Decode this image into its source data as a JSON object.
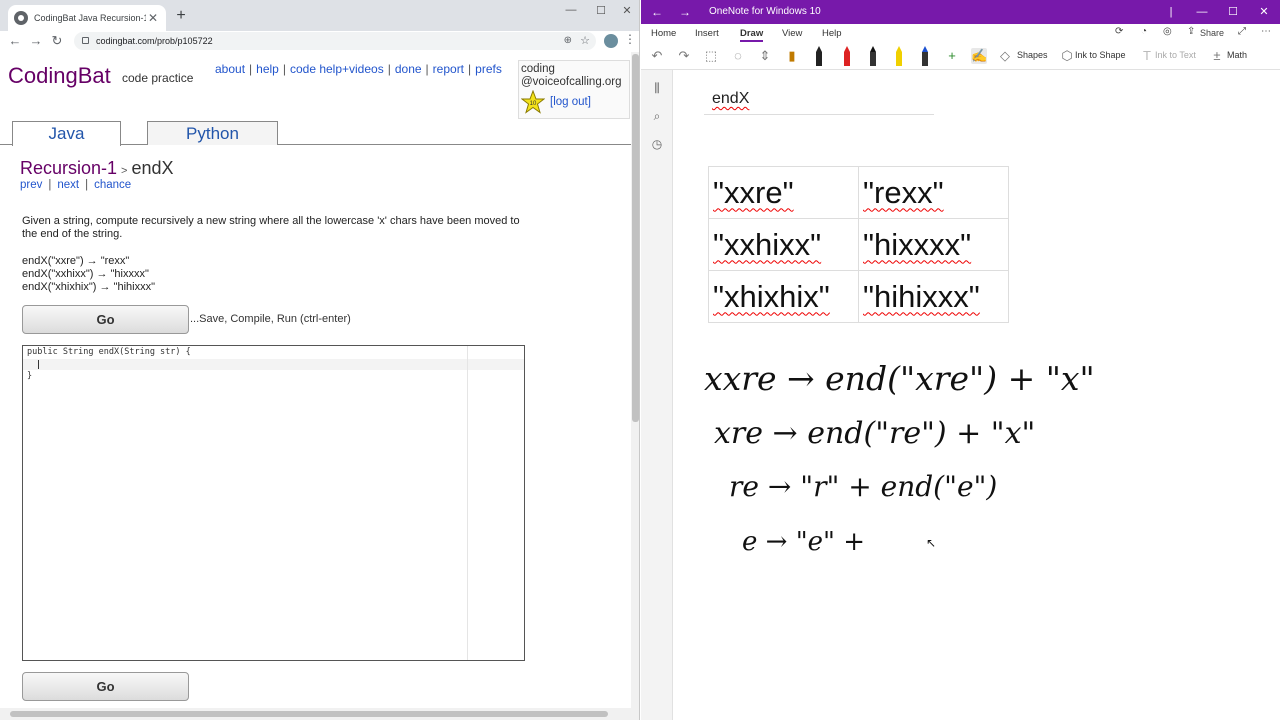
{
  "browser": {
    "tab_title": "CodingBat Java Recursion-1 endX",
    "new_tab": "+",
    "url": "codingbat.com/prob/p105722",
    "win_minimize": "—",
    "win_maximize": "☐",
    "win_close": "✕"
  },
  "site": {
    "logo": "CodingBat",
    "logo_sub": "code practice",
    "links": [
      "about",
      "help",
      "code help+videos",
      "done",
      "report",
      "prefs"
    ],
    "user_line1": "coding",
    "user_line2": "@voiceofcalling.org",
    "star_number": "10",
    "logout": "[log out]",
    "lang_tabs": [
      "Java",
      "Python"
    ],
    "crumb_section": "Recursion-1",
    "crumb_sep": ">",
    "crumb_problem": "endX",
    "subnav": [
      "prev",
      "next",
      "chance"
    ],
    "description": "Given a string, compute recursively a new string where all the lowercase 'x' chars have been moved to the end of the string.",
    "examples": [
      "endX(\"xxre\") → \"rexx\"",
      "endX(\"xxhixx\") → \"hixxxx\"",
      "endX(\"xhixhix\") → \"hihixxx\""
    ],
    "go_label": "Go",
    "run_hint": "...Save, Compile, Run (ctrl-enter)",
    "code_lines": [
      "public String endX(String str) {",
      "  ",
      "}"
    ]
  },
  "onenote": {
    "title": "OneNote for Windows 10",
    "menu": [
      "Home",
      "Insert",
      "Draw",
      "View",
      "Help"
    ],
    "share": "Share",
    "ribbon": {
      "shapes": "Shapes",
      "ink_to_shape": "Ink to Shape",
      "ink_to_text": "Ink to Text",
      "math": "Math"
    },
    "page_title": "endX",
    "table": [
      [
        "\"xxre\"",
        "\"rexx\""
      ],
      [
        "\"xxhixx\"",
        "\"hixxxx\""
      ],
      [
        "\"xhixhix\"",
        "\"hihixxx\""
      ]
    ],
    "ink_lines": [
      "xxre → end(\"xre\") + \"x\"",
      "xre → end(\"re\") + \"x\"",
      "re → \"r\" + end(\"e\")",
      "e → \"e\" +"
    ]
  },
  "colors": {
    "onenote_purple": "#7719aa",
    "codingbat_purple": "#660066",
    "link_blue": "#2255cc"
  }
}
